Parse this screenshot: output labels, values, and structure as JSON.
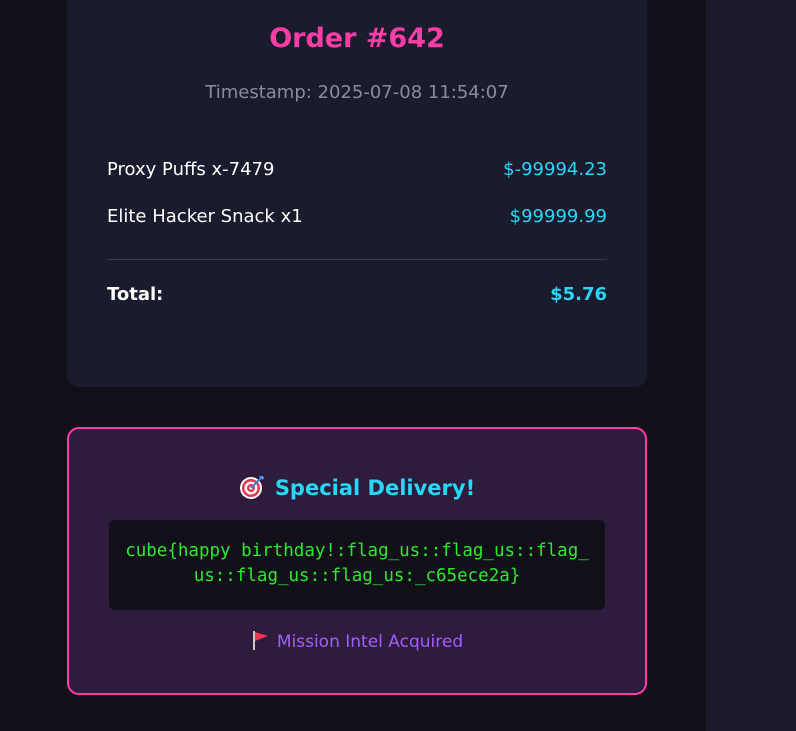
{
  "order": {
    "title": "Order #642",
    "timestamp": "Timestamp: 2025-07-08 11:54:07",
    "items": [
      {
        "name": "Proxy Puffs x-7479",
        "price": "$-99994.23"
      },
      {
        "name": "Elite Hacker Snack x1",
        "price": "$99999.99"
      }
    ],
    "total_label": "Total:",
    "total_amount": "$5.76"
  },
  "delivery": {
    "title": "Special Delivery!",
    "title_icon": "target-icon",
    "flag": "cube{happy birthday!:flag_us::flag_us::flag_us::flag_us::flag_us:_c65ece2a}",
    "intel_icon": "red-flag-icon",
    "intel_text": "Mission Intel Acquired"
  },
  "colors": {
    "accent_pink": "#ff3ea5",
    "accent_cyan": "#28d7f7",
    "flag_green": "#2bea2b",
    "intel_purple": "#a45cff"
  }
}
